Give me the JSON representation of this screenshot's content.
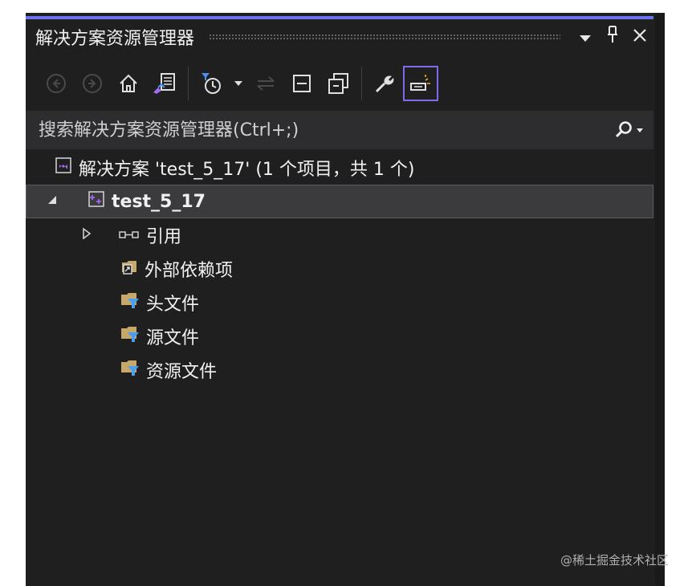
{
  "panel": {
    "title": "解决方案资源管理器",
    "accent_color": "#6b74ee"
  },
  "titlebar": {
    "dropdown_icon": "triangle-down-icon",
    "pin_icon": "pin-icon",
    "close_icon": "close-icon"
  },
  "toolbar": {
    "items": [
      "back-icon",
      "forward-icon",
      "home-icon",
      "switch-views-icon",
      "pending-changes-filter-icon",
      "dropdown-icon",
      "sync-icon",
      "collapse-all-icon",
      "show-all-files-icon",
      "properties-icon",
      "preview-selected-icon"
    ]
  },
  "search": {
    "placeholder": "搜索解决方案资源管理器(Ctrl+;)"
  },
  "tree": {
    "solution": "解决方案 'test_5_17' (1 个项目，共 1 个)",
    "project": "test_5_17",
    "references": "引用",
    "external_dependencies": "外部依赖项",
    "header_files": "头文件",
    "source_files": "源文件",
    "resource_files": "资源文件"
  },
  "watermark": "@稀土掘金技术社区"
}
